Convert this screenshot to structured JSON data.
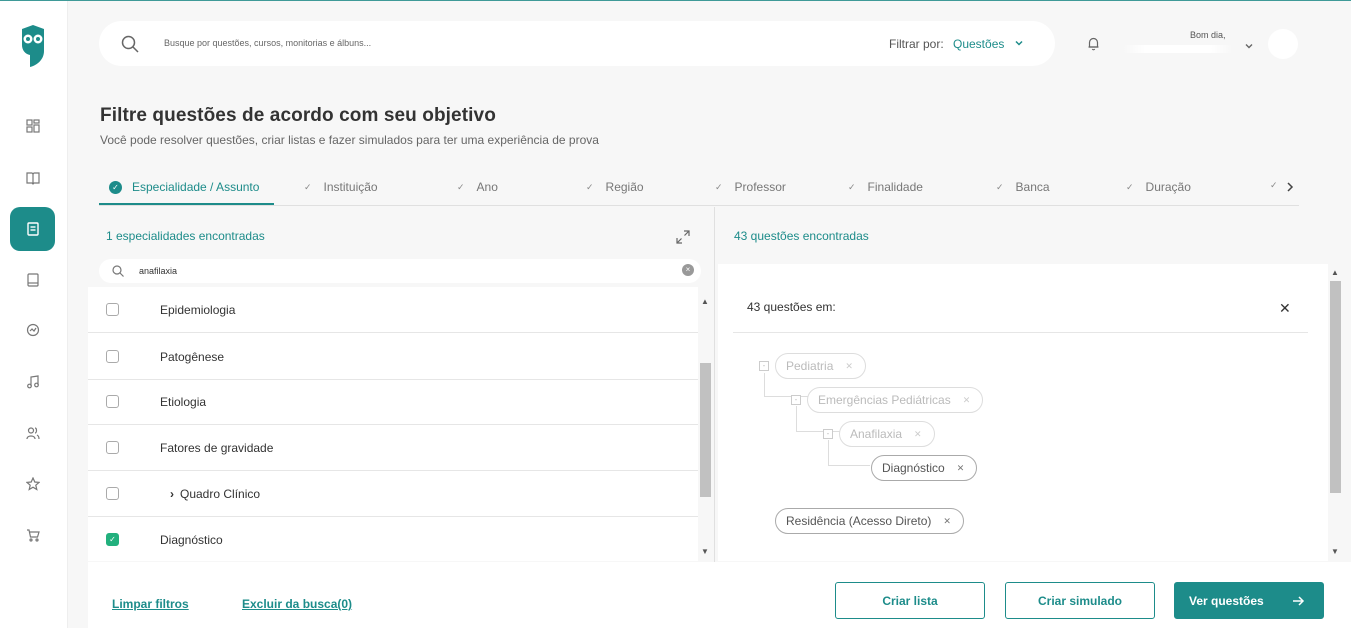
{
  "colors": {
    "accent": "#1d8c8a",
    "check": "#22b07d"
  },
  "nav": {
    "items": [
      {
        "name": "dashboard-icon"
      },
      {
        "name": "book-open-icon"
      },
      {
        "name": "questions-icon",
        "active": true
      },
      {
        "name": "notebook-icon"
      },
      {
        "name": "progress-icon"
      },
      {
        "name": "music-icon"
      },
      {
        "name": "users-icon"
      },
      {
        "name": "star-icon"
      },
      {
        "name": "cart-icon"
      }
    ]
  },
  "search": {
    "placeholder": "Busque por questões, cursos, monitorias e álbuns...",
    "filter_label": "Filtrar por:",
    "filter_value": "Questões"
  },
  "user": {
    "greeting": "Bom dia,"
  },
  "page": {
    "title": "Filtre questões de acordo com seu objetivo",
    "subtitle": "Você pode resolver questões, criar listas e fazer simulados para ter uma experiência de prova"
  },
  "tabs": [
    {
      "label": "Especialidade / Assunto",
      "active": true
    },
    {
      "label": "Instituição"
    },
    {
      "label": "Ano"
    },
    {
      "label": "Região"
    },
    {
      "label": "Professor"
    },
    {
      "label": "Finalidade"
    },
    {
      "label": "Banca"
    },
    {
      "label": "Duração"
    }
  ],
  "left": {
    "count": "1 especialidades encontradas",
    "search_value": "anafilaxia",
    "items": [
      {
        "label": "Epidemiologia",
        "checked": false
      },
      {
        "label": "Patogênese",
        "checked": false
      },
      {
        "label": "Etiologia",
        "checked": false
      },
      {
        "label": "Fatores de gravidade",
        "checked": false
      },
      {
        "label": "Quadro Clínico",
        "checked": false,
        "expandable": true
      },
      {
        "label": "Diagnóstico",
        "checked": true
      }
    ]
  },
  "right": {
    "count": "43 questões encontradas",
    "box_title": "43 questões em:",
    "tree": [
      "Pediatria",
      "Emergências Pediátricas",
      "Anafilaxia",
      "Diagnóstico"
    ],
    "extra": "Residência (Acesso Direto)"
  },
  "footer": {
    "clear": "Limpar filtros",
    "exclude": "Excluir da busca(0)",
    "create_list": "Criar lista",
    "create_sim": "Criar simulado",
    "see": "Ver questões"
  }
}
